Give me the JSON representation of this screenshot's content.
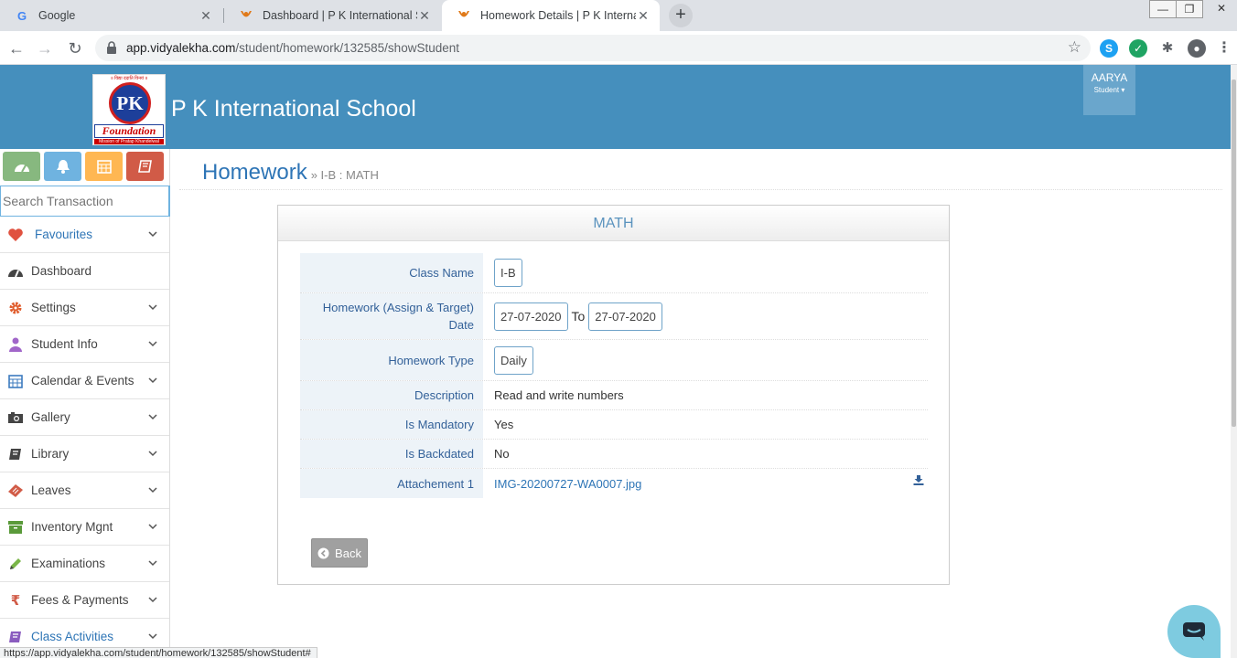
{
  "browser": {
    "tabs": [
      {
        "title": "Google",
        "favicon": "google-icon"
      },
      {
        "title": "Dashboard | P K International Sch",
        "favicon": "school-favicon"
      },
      {
        "title": "Homework Details | P K Internatio",
        "favicon": "school-favicon",
        "active": true
      }
    ],
    "url_host": "app.vidyalekha.com",
    "url_path": "/student/homework/132585/showStudent",
    "status_url": "https://app.vidyalekha.com/student/homework/132585/showStudent#"
  },
  "header": {
    "logo_tagline": "॥ विद्या ददाति विनयं ॥",
    "logo_initials": "PK",
    "logo_text": "Foundation",
    "logo_sub": "Mission of Pratap Khandelwal",
    "school_name": "P K International School",
    "user_name": "AARYA",
    "user_role": "Student",
    "color": "#458fbd"
  },
  "sidebar": {
    "shortcut_colors": [
      "#87b87f",
      "#6fb3e0",
      "#ffb752",
      "#d15b47"
    ],
    "search_placeholder": "Search Transaction",
    "items": [
      {
        "label": "Favourites",
        "icon": "heart-icon"
      },
      {
        "label": "Dashboard",
        "icon": "dashboard-icon"
      },
      {
        "label": "Settings",
        "icon": "gear-icon"
      },
      {
        "label": "Student Info",
        "icon": "user-icon"
      },
      {
        "label": "Calendar & Events",
        "icon": "calendar-icon"
      },
      {
        "label": "Gallery",
        "icon": "camera-icon"
      },
      {
        "label": "Library",
        "icon": "book-icon"
      },
      {
        "label": "Leaves",
        "icon": "ticket-icon"
      },
      {
        "label": "Inventory Mgnt",
        "icon": "archive-icon"
      },
      {
        "label": "Examinations",
        "icon": "pencil-icon"
      },
      {
        "label": "Fees & Payments",
        "icon": "rupee-icon"
      },
      {
        "label": "Class Activities",
        "icon": "book-icon"
      }
    ]
  },
  "page": {
    "title": "Homework",
    "breadcrumb": "» I-B : MATH"
  },
  "card": {
    "heading": "MATH",
    "rows": {
      "class_name_label": "Class Name",
      "class_name_value": "I-B",
      "date_label": "Homework (Assign & Target) Date",
      "date_from": "27-07-2020",
      "date_to_word": "To",
      "date_to": "27-07-2020",
      "type_label": "Homework Type",
      "type_value": "Daily",
      "description_label": "Description",
      "description_value": "Read and write numbers",
      "mandatory_label": "Is Mandatory",
      "mandatory_value": "Yes",
      "backdated_label": "Is Backdated",
      "backdated_value": "No",
      "attachment_label": "Attachement 1",
      "attachment_value": "IMG-20200727-WA0007.jpg"
    },
    "back_label": "Back"
  }
}
